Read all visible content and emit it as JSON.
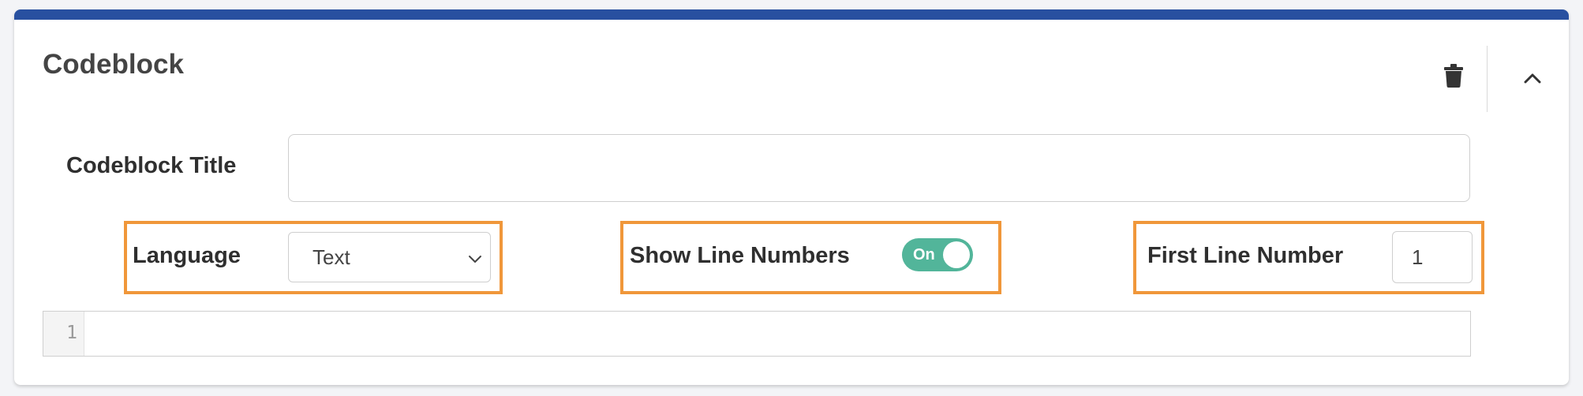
{
  "panel": {
    "title": "Codeblock",
    "accent_color": "#2850a0",
    "actions": [
      {
        "name": "delete",
        "icon": "trash-icon"
      },
      {
        "name": "collapse",
        "icon": "chevron-up-icon"
      }
    ]
  },
  "form": {
    "title_field": {
      "label": "Codeblock Title",
      "value": "",
      "placeholder": ""
    },
    "language": {
      "label": "Language",
      "selected": "Text"
    },
    "show_line_numbers": {
      "label": "Show Line Numbers",
      "state_label": "On",
      "on": true,
      "color": "#52b59a"
    },
    "first_line_number": {
      "label": "First Line Number",
      "value": "1"
    }
  },
  "editor": {
    "line_numbers": [
      "1"
    ],
    "content": ""
  },
  "highlight_color": "#f0973a"
}
